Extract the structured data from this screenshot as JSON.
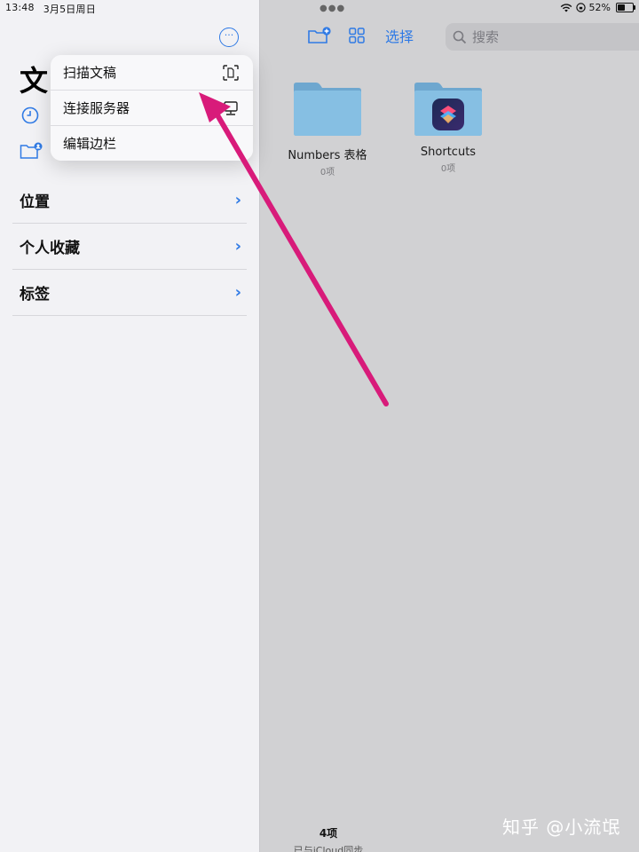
{
  "status": {
    "time": "13:48",
    "date": "3月5日周日",
    "battery": "52%",
    "battery_level": 0.52
  },
  "sidebar": {
    "title": "文",
    "more_label": "···",
    "sections": [
      {
        "label": "位置"
      },
      {
        "label": "个人收藏"
      },
      {
        "label": "标签"
      }
    ]
  },
  "menu": {
    "items": [
      {
        "label": "扫描文稿",
        "icon": "scan-document-icon"
      },
      {
        "label": "连接服务器",
        "icon": "server-icon"
      },
      {
        "label": "编辑边栏",
        "icon": ""
      }
    ]
  },
  "toolbar": {
    "select_label": "选择",
    "search_placeholder": "搜索"
  },
  "folders": [
    {
      "name": "Numbers 表格",
      "count": "0项"
    },
    {
      "name": "Shortcuts",
      "count": "0项"
    }
  ],
  "footer": {
    "count": "4项",
    "sync": "已与iCloud同步"
  },
  "watermark": "知乎 @小流氓",
  "colors": {
    "accent": "#2f7ae5",
    "arrow": "#d81b7a",
    "folder": "#7fb6dd"
  }
}
